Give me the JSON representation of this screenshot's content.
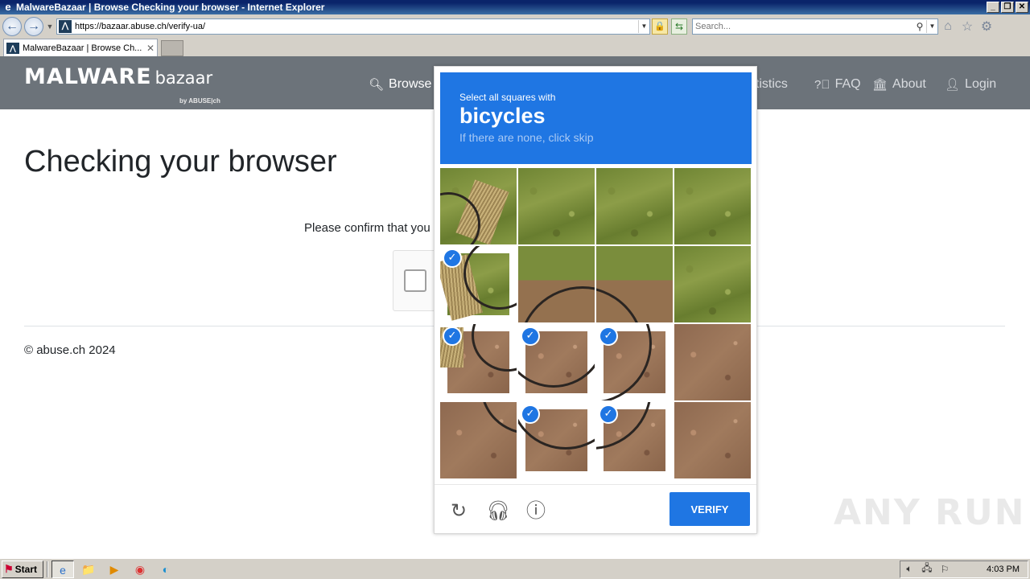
{
  "window": {
    "title": "MalwareBazaar | Browse Checking your browser - Internet Explorer",
    "address": "https://bazaar.abuse.ch/verify-ua/",
    "search_placeholder": "Search...",
    "tab_title": "MalwareBazaar | Browse Ch...",
    "icons": [
      "ie-icon",
      "back-icon",
      "forward-icon",
      "lock-icon",
      "refresh-icon",
      "search-icon",
      "home-icon",
      "star-icon",
      "gear-icon"
    ]
  },
  "site": {
    "brand_malware": "MALWARE",
    "brand_bazaar": "bazaar",
    "brand_by": "by ABUSE|ch",
    "nav": {
      "browse": "Browse",
      "statistics": "Statistics",
      "statistics_visible": "atistics",
      "faq": "FAQ",
      "about": "About",
      "login": "Login"
    },
    "page_title": "Checking your browser",
    "confirm_text": "Please confirm that you",
    "copyright": "© abuse.ch 2024"
  },
  "captcha": {
    "prompt_line1": "Select all squares with",
    "prompt_object": "bicycles",
    "prompt_hint": "If there are none, click skip",
    "verify_label": "VERIFY",
    "accent_color": "#1f76e3",
    "tiles": [
      {
        "row": 1,
        "col": 1,
        "selected": false
      },
      {
        "row": 1,
        "col": 2,
        "selected": false
      },
      {
        "row": 1,
        "col": 3,
        "selected": false
      },
      {
        "row": 1,
        "col": 4,
        "selected": false
      },
      {
        "row": 2,
        "col": 1,
        "selected": true
      },
      {
        "row": 2,
        "col": 2,
        "selected": false
      },
      {
        "row": 2,
        "col": 3,
        "selected": false
      },
      {
        "row": 2,
        "col": 4,
        "selected": false
      },
      {
        "row": 3,
        "col": 1,
        "selected": true
      },
      {
        "row": 3,
        "col": 2,
        "selected": true
      },
      {
        "row": 3,
        "col": 3,
        "selected": true
      },
      {
        "row": 3,
        "col": 4,
        "selected": false
      },
      {
        "row": 4,
        "col": 1,
        "selected": false
      },
      {
        "row": 4,
        "col": 2,
        "selected": true
      },
      {
        "row": 4,
        "col": 3,
        "selected": true
      },
      {
        "row": 4,
        "col": 4,
        "selected": false
      }
    ]
  },
  "watermark": "ANY RUN",
  "taskbar": {
    "start_label": "Start",
    "clock": "4:03 PM"
  }
}
